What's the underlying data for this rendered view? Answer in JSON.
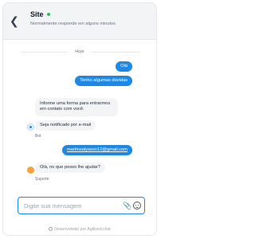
{
  "header": {
    "title": "Site",
    "subtitle": "Normalmente responde em alguns minutos",
    "status_color": "#22c55e"
  },
  "conversation": {
    "date_label": "Hoje",
    "messages": [
      {
        "from": "user",
        "text": "Olá"
      },
      {
        "from": "user",
        "text": "Tenho algumas dúvidas"
      },
      {
        "from": "bot",
        "text": "Informe uma forma para entrarmos em contato com você."
      },
      {
        "from": "bot",
        "text": "Seja notificado por e-mail"
      },
      {
        "from": "user",
        "text": "martinsalysson12@gmail.com"
      },
      {
        "from": "support",
        "text": "Olá, no que posso lhe ajudar?"
      }
    ],
    "bot_label": "Bot",
    "support_label": "Suporte"
  },
  "composer": {
    "placeholder": "Digite sua mensagem",
    "attach_icon": "paperclip-icon",
    "emoji_icon": "smiley-icon"
  },
  "footer": {
    "text": "Desenvolvido por Agilized.chat"
  },
  "colors": {
    "accent": "#1e88e5",
    "incoming_bubble": "#f3f4f6"
  }
}
